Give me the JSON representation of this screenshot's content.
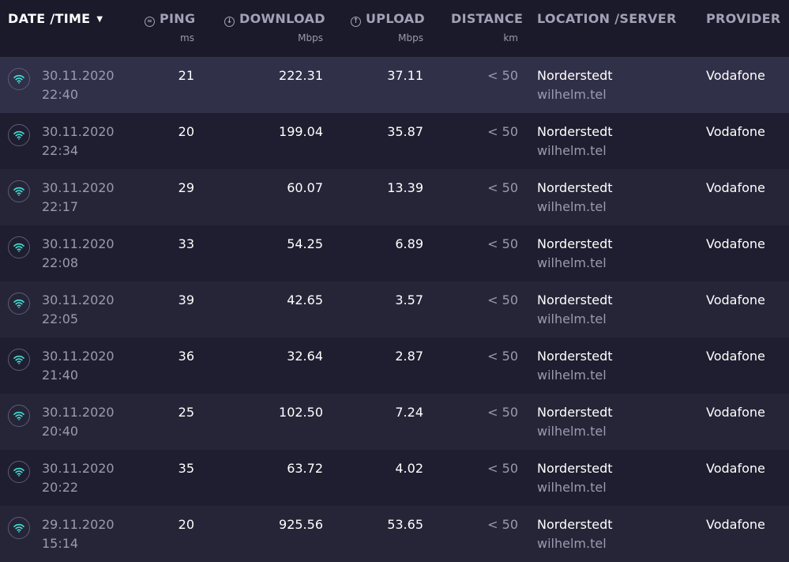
{
  "header": {
    "date_time": "DATE /TIME",
    "sort_caret": "▼",
    "ping": "PING",
    "ping_unit": "ms",
    "download": "DOWNLOAD",
    "download_unit": "Mbps",
    "upload": "UPLOAD",
    "upload_unit": "Mbps",
    "distance": "DISTANCE",
    "distance_unit": "km",
    "location": "LOCATION /SERVER",
    "provider": "PROVIDER"
  },
  "rows": [
    {
      "date": "30.11.2020",
      "time": "22:40",
      "ping": "21",
      "download": "222.31",
      "upload": "37.11",
      "distance": "< 50",
      "location": "Norderstedt",
      "server": "wilhelm.tel",
      "provider": "Vodafone"
    },
    {
      "date": "30.11.2020",
      "time": "22:34",
      "ping": "20",
      "download": "199.04",
      "upload": "35.87",
      "distance": "< 50",
      "location": "Norderstedt",
      "server": "wilhelm.tel",
      "provider": "Vodafone"
    },
    {
      "date": "30.11.2020",
      "time": "22:17",
      "ping": "29",
      "download": "60.07",
      "upload": "13.39",
      "distance": "< 50",
      "location": "Norderstedt",
      "server": "wilhelm.tel",
      "provider": "Vodafone"
    },
    {
      "date": "30.11.2020",
      "time": "22:08",
      "ping": "33",
      "download": "54.25",
      "upload": "6.89",
      "distance": "< 50",
      "location": "Norderstedt",
      "server": "wilhelm.tel",
      "provider": "Vodafone"
    },
    {
      "date": "30.11.2020",
      "time": "22:05",
      "ping": "39",
      "download": "42.65",
      "upload": "3.57",
      "distance": "< 50",
      "location": "Norderstedt",
      "server": "wilhelm.tel",
      "provider": "Vodafone"
    },
    {
      "date": "30.11.2020",
      "time": "21:40",
      "ping": "36",
      "download": "32.64",
      "upload": "2.87",
      "distance": "< 50",
      "location": "Norderstedt",
      "server": "wilhelm.tel",
      "provider": "Vodafone"
    },
    {
      "date": "30.11.2020",
      "time": "20:40",
      "ping": "25",
      "download": "102.50",
      "upload": "7.24",
      "distance": "< 50",
      "location": "Norderstedt",
      "server": "wilhelm.tel",
      "provider": "Vodafone"
    },
    {
      "date": "30.11.2020",
      "time": "20:22",
      "ping": "35",
      "download": "63.72",
      "upload": "4.02",
      "distance": "< 50",
      "location": "Norderstedt",
      "server": "wilhelm.tel",
      "provider": "Vodafone"
    },
    {
      "date": "29.11.2020",
      "time": "15:14",
      "ping": "20",
      "download": "925.56",
      "upload": "53.65",
      "distance": "< 50",
      "location": "Norderstedt",
      "server": "wilhelm.tel",
      "provider": "Vodafone"
    }
  ],
  "icons": {
    "connection": "wifi-icon",
    "ping": "ping-icon",
    "download": "download-arrow-icon",
    "upload": "upload-arrow-icon"
  },
  "colors": {
    "background": "#1b1b2b",
    "row_highlight": "#313049",
    "wifi_accent": "#3fe1d6",
    "muted_text": "#9a9aaf"
  }
}
